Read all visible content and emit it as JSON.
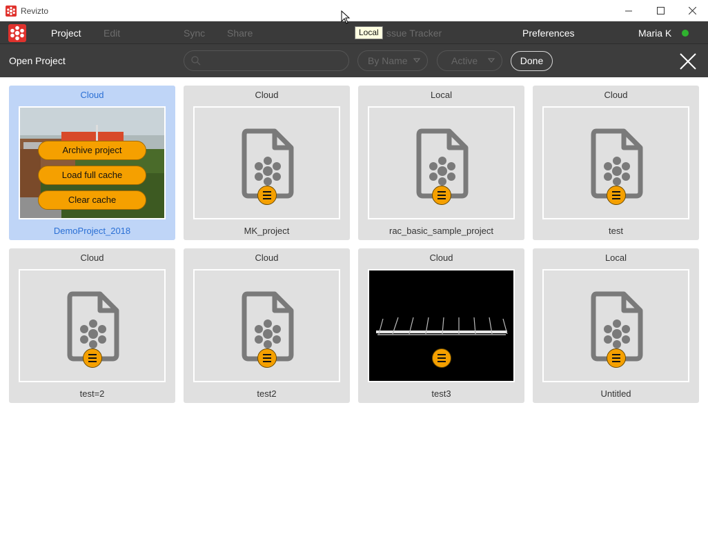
{
  "window": {
    "title": "Revizto",
    "controls": {
      "minimize": "minimize-icon",
      "maximize": "maximize-icon",
      "close": "close-icon"
    }
  },
  "menubar": {
    "items": [
      {
        "label": "Project",
        "enabled": true
      },
      {
        "label": "Edit",
        "enabled": false
      },
      {
        "label": "Sync",
        "enabled": false
      },
      {
        "label": "Share",
        "enabled": false
      },
      {
        "label": "ssue Tracker",
        "enabled": false
      },
      {
        "label": "Preferences",
        "enabled": true
      }
    ],
    "user": {
      "name": "Maria K",
      "status_color": "#2fb32f"
    }
  },
  "tooltip": {
    "text": "Local"
  },
  "toolbar": {
    "heading": "Open Project",
    "search": {
      "placeholder": "",
      "value": ""
    },
    "sort": {
      "selected": "By Name"
    },
    "filter": {
      "selected": "Active"
    },
    "done_label": "Done"
  },
  "projects": [
    {
      "name": "DemoProject_2018",
      "status": "Cloud",
      "selected": true,
      "thumbnail": "render",
      "actions": [
        "Archive project",
        "Load full cache",
        "Clear cache"
      ]
    },
    {
      "name": "MK_project",
      "status": "Cloud",
      "selected": false,
      "thumbnail": "file-icon"
    },
    {
      "name": "rac_basic_sample_project",
      "status": "Local",
      "selected": false,
      "thumbnail": "file-icon"
    },
    {
      "name": "test",
      "status": "Cloud",
      "selected": false,
      "thumbnail": "file-icon"
    },
    {
      "name": "test=2",
      "status": "Cloud",
      "selected": false,
      "thumbnail": "file-icon"
    },
    {
      "name": "test2",
      "status": "Cloud",
      "selected": false,
      "thumbnail": "file-icon"
    },
    {
      "name": "test3",
      "status": "Cloud",
      "selected": false,
      "thumbnail": "black-render"
    },
    {
      "name": "Untitled",
      "status": "Local",
      "selected": false,
      "thumbnail": "file-icon"
    }
  ],
  "colors": {
    "accent_orange": "#f5a000",
    "selected_card": "#bfd5f7",
    "selected_text": "#2a6fd4",
    "menubar_bg": "#3a3a3a"
  }
}
